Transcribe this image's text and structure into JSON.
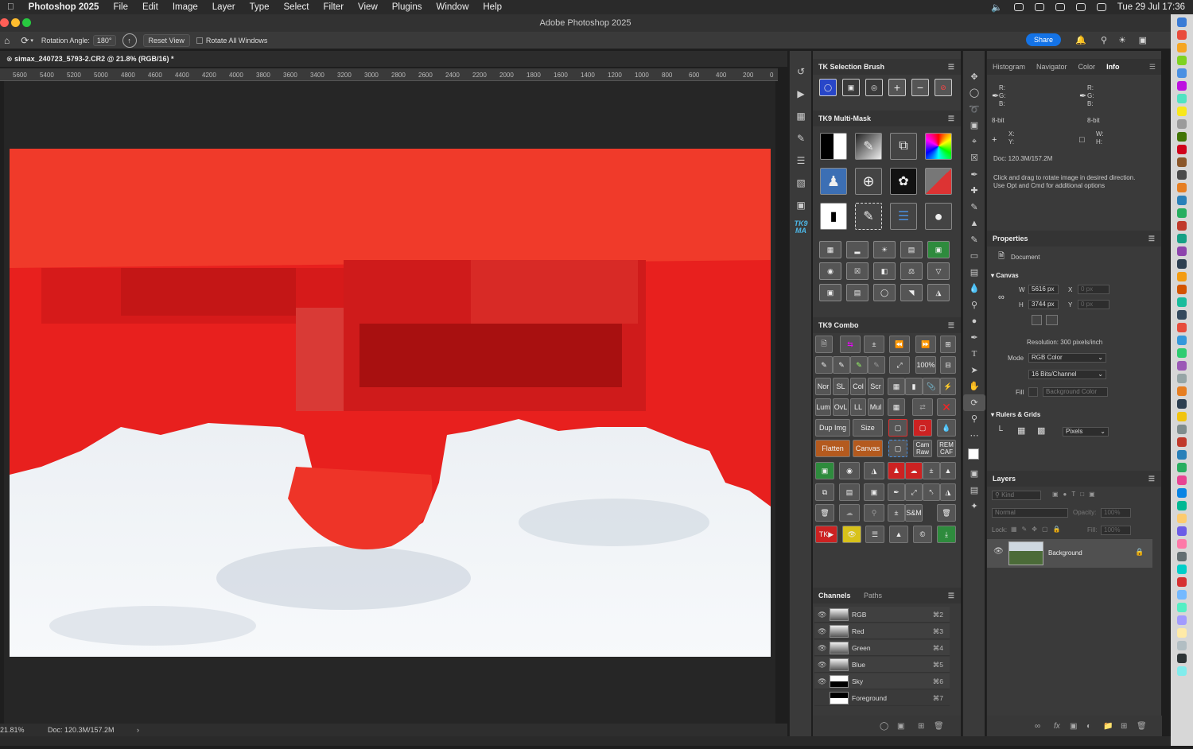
{
  "menubar": {
    "app": "Photoshop 2025",
    "items": [
      "File",
      "Edit",
      "Image",
      "Layer",
      "Type",
      "Select",
      "Filter",
      "View",
      "Plugins",
      "Window",
      "Help"
    ],
    "clock": "Tue 29 Jul  17:36"
  },
  "window": {
    "title": "Adobe Photoshop 2025"
  },
  "options": {
    "rotation_label": "Rotation Angle:",
    "rotation_value": "180°",
    "reset_view": "Reset View",
    "rotate_all": "Rotate All Windows",
    "share": "Share"
  },
  "document": {
    "tab": "simax_240723_5793-2.CR2 @ 21.8% (RGB/16) *",
    "zoom": "21.81%",
    "doc_size": "Doc: 120.3M/157.2M"
  },
  "ruler": [
    "5600",
    "5400",
    "5200",
    "5000",
    "4800",
    "4600",
    "4400",
    "4200",
    "4000",
    "3800",
    "3600",
    "3400",
    "3200",
    "3000",
    "2800",
    "2600",
    "2400",
    "2200",
    "2000",
    "1800",
    "1600",
    "1400",
    "1200",
    "1000",
    "800",
    "600",
    "400",
    "200",
    "0"
  ],
  "tk": {
    "selection_title": "TK Selection Brush",
    "multimask_title": "TK9 Multi-Mask",
    "combo_title": "TK9 Combo",
    "combo_labels": {
      "pct": "100%",
      "nor": "Nor",
      "sl": "SL",
      "col": "Col",
      "scr": "Scr",
      "lum": "Lum",
      "ovl": "OvL",
      "ll": "LL",
      "mul": "Mul",
      "dup": "Dup Img",
      "size": "Size",
      "flatten": "Flatten",
      "canvas": "Canvas",
      "cam1": "Cam",
      "cam2": "Raw",
      "rem1": "REM",
      "rem2": "CAF",
      "sm": "S&M",
      "tk": "TK"
    },
    "side_label": "TK9 MA"
  },
  "channels": {
    "tab1": "Channels",
    "tab2": "Paths",
    "rows": [
      {
        "name": "RGB",
        "shortcut": "⌘2"
      },
      {
        "name": "Red",
        "shortcut": "⌘3"
      },
      {
        "name": "Green",
        "shortcut": "⌘4"
      },
      {
        "name": "Blue",
        "shortcut": "⌘5"
      },
      {
        "name": "Sky",
        "shortcut": "⌘6"
      },
      {
        "name": "Foreground",
        "shortcut": "⌘7"
      }
    ]
  },
  "info": {
    "tabs": [
      "Histogram",
      "Navigator",
      "Color",
      "Info"
    ],
    "r": "R:",
    "g": "G:",
    "b": "B:",
    "bit1": "8-bit",
    "bit2": "8-bit",
    "x": "X:",
    "y": "Y:",
    "w": "W:",
    "h": "H:",
    "doc": "Doc: 120.3M/157.2M",
    "hint1": "Click and drag to rotate image in desired direction.",
    "hint2": "Use Opt and Cmd for additional options"
  },
  "properties": {
    "title": "Properties",
    "doc_label": "Document",
    "canvas": "Canvas",
    "w_label": "W",
    "w": "5616 px",
    "h_label": "H",
    "h": "3744 px",
    "x_label": "X",
    "x": "0 px",
    "y_label": "Y",
    "y": "0 px",
    "resolution": "Resolution: 300 pixels/inch",
    "mode_label": "Mode",
    "mode": "RGB Color",
    "depth": "16 Bits/Channel",
    "fill_label": "Fill",
    "fill": "Background Color",
    "rulers": "Rulers & Grids",
    "units": "Pixels"
  },
  "layers": {
    "title": "Layers",
    "kind": "Kind",
    "blend": "Normal",
    "opacity_label": "Opacity:",
    "opacity": "100%",
    "lock_label": "Lock:",
    "fill_label": "Fill:",
    "fill": "100%",
    "layer_name": "Background"
  }
}
